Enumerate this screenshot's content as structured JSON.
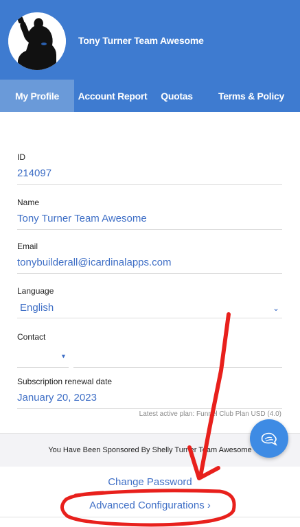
{
  "header": {
    "user_name": "Tony Turner Team Awesome",
    "avatar_icon": "bodybuilder-silhouette-avatar",
    "background_color": "#3e7bd0"
  },
  "tabs": [
    {
      "label": "My Profile",
      "active": true
    },
    {
      "label": "Account Report",
      "active": false
    },
    {
      "label": "Quotas",
      "active": false
    },
    {
      "label": "Terms & Policy",
      "active": false
    }
  ],
  "profile": {
    "id": {
      "label": "ID",
      "value": "214097"
    },
    "name": {
      "label": "Name",
      "value": "Tony Turner Team Awesome"
    },
    "email": {
      "label": "Email",
      "value": "tonybuilderall@icardinalapps.com"
    },
    "language": {
      "label": "Language",
      "value": "English",
      "icon": "chevron-down-icon"
    },
    "contact": {
      "label": "Contact",
      "country_code": "",
      "phone": ""
    },
    "renewal": {
      "label": "Subscription renewal date",
      "value": "January 20, 2023"
    },
    "plan_note": "Latest active plan: Funnel Club Plan USD (4.0)"
  },
  "sponsor": {
    "text": "You Have Been Sponsored By Shelly Turner Team Awesome"
  },
  "fab": {
    "icon": "chat-bubble-icon",
    "color": "#3e8be4"
  },
  "links": {
    "change_password": "Change Password",
    "advanced_configurations": "Advanced Configurations  ›"
  },
  "annotation": {
    "color": "#e8201c"
  }
}
